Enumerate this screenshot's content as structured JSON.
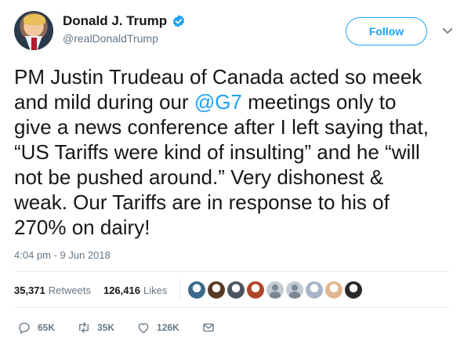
{
  "author": {
    "display_name": "Donald J. Trump",
    "handle": "@realDonaldTrump",
    "verified": true
  },
  "follow_label": "Follow",
  "tweet": {
    "lines": [
      {
        "text": "PM Justin Trudeau of Canada acted so meek"
      },
      {
        "pre": "and mild during our ",
        "mention": "@G7",
        "post": " meetings only to"
      },
      {
        "text": "give a news conference after I left saying that,"
      },
      {
        "text": "“US Tariffs were kind of insulting” and he “will"
      },
      {
        "text": "not be pushed around.” Very dishonest &"
      },
      {
        "text": "weak. Our Tariffs are in response to his of"
      },
      {
        "text": "270% on dairy!"
      }
    ],
    "timestamp": "4:04 pm - 9 Jun 2018"
  },
  "stats": {
    "retweets_count": "35,371",
    "retweets_label": "Retweets",
    "likes_count": "126,416",
    "likes_label": "Likes"
  },
  "likers": [
    {
      "color": "#3b6b8a"
    },
    {
      "color": "#5a3a22"
    },
    {
      "color": "#4a5560"
    },
    {
      "color": "#b0472a"
    },
    {
      "color": "default"
    },
    {
      "color": "default"
    },
    {
      "color": "#a8b4c8"
    },
    {
      "color": "#e0b890"
    },
    {
      "color": "#2a2a2a"
    }
  ],
  "actions": {
    "replies": "65K",
    "retweets": "35K",
    "likes": "126K"
  },
  "colors": {
    "accent": "#1da1f2",
    "secondary_text": "#657786",
    "primary_text": "#14171a",
    "divider": "#e6ecf0"
  }
}
